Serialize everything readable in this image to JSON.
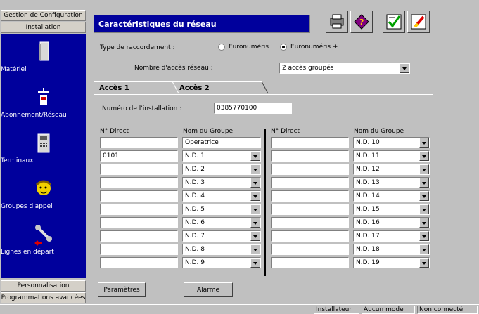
{
  "sidebar": {
    "top_buttons": [
      "Gestion de Configuration",
      "Installation"
    ],
    "items": [
      {
        "label": "Matériel",
        "icon": "hardware-icon"
      },
      {
        "label": "Abonnement/Réseau",
        "icon": "network-icon"
      },
      {
        "label": "Terminaux",
        "icon": "phone-icon"
      },
      {
        "label": "Groupes d'appel",
        "icon": "group-icon"
      },
      {
        "label": "Lignes en départ",
        "icon": "outgoing-line-icon"
      }
    ],
    "bottom_buttons": [
      "Personnalisation",
      "Programmations avancées"
    ]
  },
  "header": {
    "title": "Caractéristiques du réseau",
    "toolbar_icons": [
      "printer-icon",
      "help-book-icon",
      "checklist-icon",
      "edit-icon"
    ]
  },
  "form": {
    "raccordement_label": "Type de raccordement :",
    "radio_options": [
      {
        "label": "Euronuméris",
        "selected": false
      },
      {
        "label": "Euronuméris +",
        "selected": true
      }
    ],
    "nb_acces_label": "Nombre d'accès réseau :",
    "nb_acces_value": "2 accès groupés"
  },
  "tabs": [
    {
      "label": "Accès 1",
      "active": true
    },
    {
      "label": "Accès 2",
      "active": false
    }
  ],
  "installation": {
    "label": "Numéro de l'installation :",
    "value": "0385770100"
  },
  "table": {
    "headers": {
      "direct": "N° Direct",
      "group": "Nom du Groupe"
    },
    "left": [
      {
        "direct": "",
        "group": "Operatrice",
        "has_dropdown": false
      },
      {
        "direct": "0101",
        "group": "N.D. 1",
        "has_dropdown": true
      },
      {
        "direct": "",
        "group": "N.D. 2",
        "has_dropdown": true
      },
      {
        "direct": "",
        "group": "N.D. 3",
        "has_dropdown": true
      },
      {
        "direct": "",
        "group": "N.D. 4",
        "has_dropdown": true
      },
      {
        "direct": "",
        "group": "N.D. 5",
        "has_dropdown": true
      },
      {
        "direct": "",
        "group": "N.D. 6",
        "has_dropdown": true
      },
      {
        "direct": "",
        "group": "N.D. 7",
        "has_dropdown": true
      },
      {
        "direct": "",
        "group": "N.D. 8",
        "has_dropdown": true
      },
      {
        "direct": "",
        "group": "N.D. 9",
        "has_dropdown": true
      }
    ],
    "right": [
      {
        "direct": "",
        "group": "N.D. 10"
      },
      {
        "direct": "",
        "group": "N.D. 11"
      },
      {
        "direct": "",
        "group": "N.D. 12"
      },
      {
        "direct": "",
        "group": "N.D. 13"
      },
      {
        "direct": "",
        "group": "N.D. 14"
      },
      {
        "direct": "",
        "group": "N.D. 15"
      },
      {
        "direct": "",
        "group": "N.D. 16"
      },
      {
        "direct": "",
        "group": "N.D. 17"
      },
      {
        "direct": "",
        "group": "N.D. 18"
      },
      {
        "direct": "",
        "group": "N.D. 19"
      }
    ]
  },
  "buttons": {
    "parametres": "Paramètres",
    "alarme": "Alarme"
  },
  "status": [
    "Installateur",
    "Aucun mode",
    "Non connecté"
  ],
  "colors": {
    "panel_blue": "#00009c",
    "window_gray": "#c0c0c0"
  }
}
